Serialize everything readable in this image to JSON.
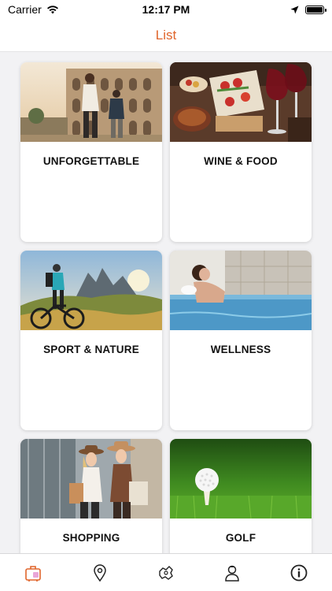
{
  "status": {
    "carrier": "Carrier",
    "time": "12:17 PM"
  },
  "header": {
    "title": "List"
  },
  "cards": [
    {
      "title": "UNFORGETTABLE"
    },
    {
      "title": "WINE & FOOD"
    },
    {
      "title": "SPORT & NATURE"
    },
    {
      "title": "WELLNESS"
    },
    {
      "title": "SHOPPING"
    },
    {
      "title": "GOLF"
    }
  ],
  "tabs": [
    {
      "icon": "suitcase-icon",
      "active": true,
      "color": "#e0652b"
    },
    {
      "icon": "map-pin-icon",
      "active": false
    },
    {
      "icon": "map-icon",
      "active": false
    },
    {
      "icon": "person-icon",
      "active": false
    },
    {
      "icon": "info-icon",
      "active": false
    }
  ],
  "colors": {
    "accent": "#e0652b"
  }
}
